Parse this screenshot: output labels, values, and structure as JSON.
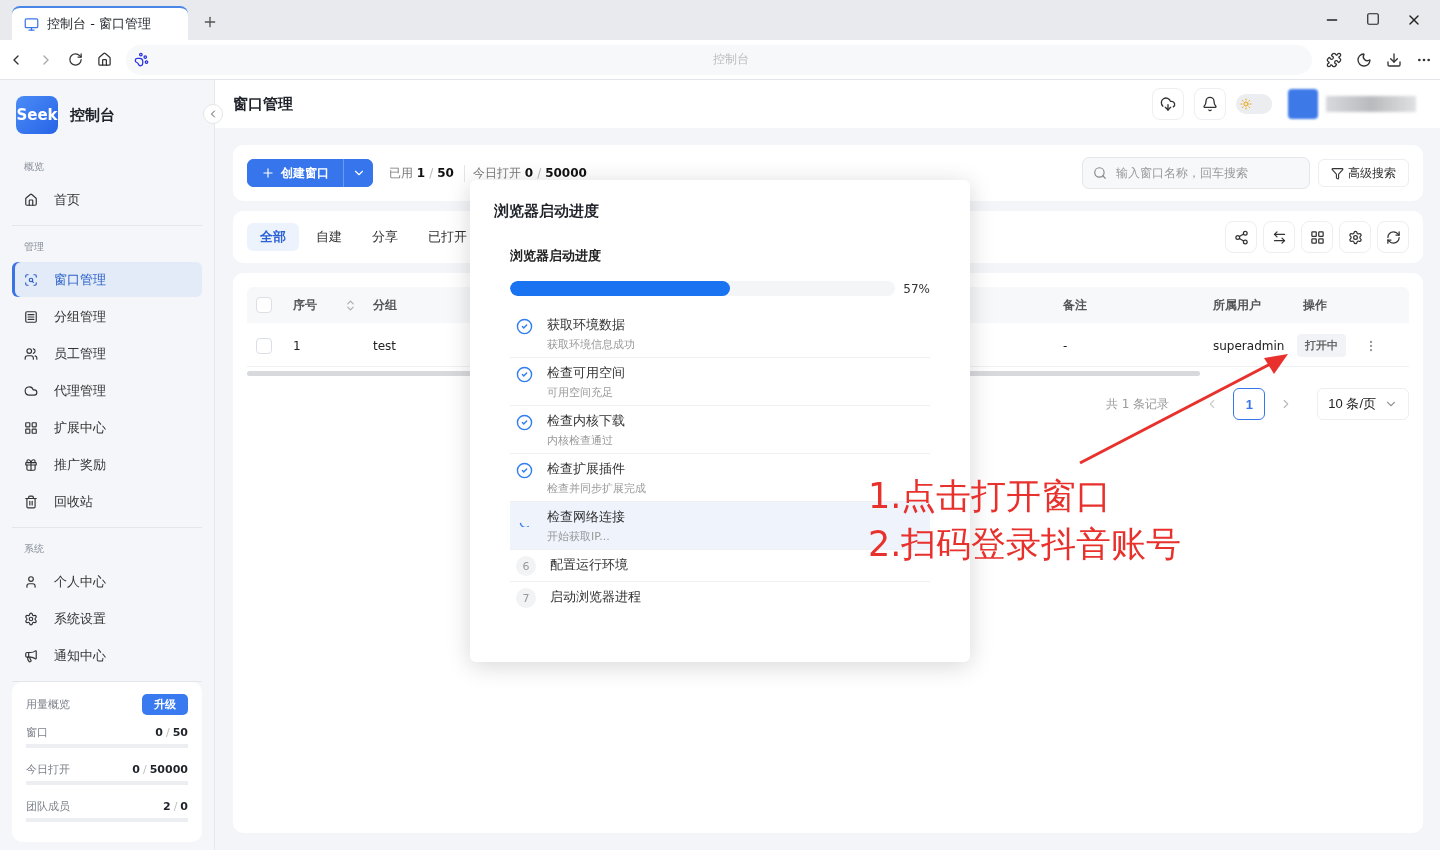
{
  "browser": {
    "tab_title": "控制台 - 窗口管理",
    "address": "控制台"
  },
  "sidebar": {
    "logo": "Seek",
    "title": "控制台",
    "sections": [
      {
        "heading": "概览",
        "items": [
          {
            "label": "首页",
            "selected": false
          }
        ]
      },
      {
        "heading": "管理",
        "items": [
          {
            "label": "窗口管理",
            "selected": true
          },
          {
            "label": "分组管理",
            "selected": false
          },
          {
            "label": "员工管理",
            "selected": false
          },
          {
            "label": "代理管理",
            "selected": false
          },
          {
            "label": "扩展中心",
            "selected": false
          },
          {
            "label": "推广奖励",
            "selected": false
          },
          {
            "label": "回收站",
            "selected": false
          }
        ]
      },
      {
        "heading": "系统",
        "items": [
          {
            "label": "个人中心",
            "selected": false
          },
          {
            "label": "系统设置",
            "selected": false
          },
          {
            "label": "通知中心",
            "selected": false
          }
        ]
      }
    ],
    "usage": {
      "title": "用量概览",
      "upgrade": "升级",
      "rows": [
        {
          "label": "窗口",
          "used": "0",
          "sep": "/",
          "total": "50"
        },
        {
          "label": "今日打开",
          "used": "0",
          "sep": "/",
          "total": "50000"
        },
        {
          "label": "团队成员",
          "used": "2",
          "sep": "/",
          "total": "0"
        }
      ]
    }
  },
  "header": {
    "title": "窗口管理",
    "theme_toggle": {
      "on": false
    }
  },
  "toolbar": {
    "create": "创建窗口",
    "stats": [
      {
        "label": "已用",
        "used": "1",
        "sep": "/",
        "total": "50"
      },
      {
        "label": "今日打开",
        "used": "0",
        "sep": "/",
        "total": "50000"
      }
    ],
    "search_placeholder": "输入窗口名称，回车搜索",
    "advanced": "高级搜索"
  },
  "tabs": [
    {
      "label": "全部",
      "selected": true
    },
    {
      "label": "自建",
      "selected": false
    },
    {
      "label": "分享",
      "selected": false
    },
    {
      "label": "已打开",
      "selected": false
    }
  ],
  "table": {
    "select_all_checked": false,
    "columns": [
      "序号",
      "分组",
      "",
      "备注",
      "所属用户",
      "操作"
    ],
    "rows": [
      {
        "checked": false,
        "cells": [
          "1",
          "test",
          "",
          "-",
          "superadmin"
        ],
        "action": "打开中"
      }
    ],
    "total": "共 1 条记录",
    "pages": [
      {
        "label": "1",
        "selected": true
      }
    ],
    "page_size": "10 条/页"
  },
  "modal": {
    "title": "浏览器启动进度",
    "subtitle": "浏览器启动进度",
    "level": 0.57,
    "reading": "57%",
    "steps": [
      {
        "kind": "done",
        "title": "获取环境数据",
        "detail": "获取环境信息成功"
      },
      {
        "kind": "done",
        "title": "检查可用空间",
        "detail": "可用空间充足"
      },
      {
        "kind": "done",
        "title": "检查内核下载",
        "detail": "内核检查通过"
      },
      {
        "kind": "done",
        "title": "检查扩展插件",
        "detail": "检查并同步扩展完成"
      },
      {
        "kind": "active",
        "title": "检查网络连接",
        "detail": "开始获取IP..."
      },
      {
        "kind": "pending",
        "number": "6",
        "title": "配置运行环境"
      },
      {
        "kind": "pending",
        "number": "7",
        "title": "启动浏览器进程"
      }
    ]
  },
  "annotation": {
    "lines": [
      "1.点击打开窗口",
      "2.扫码登录抖音账号"
    ]
  }
}
